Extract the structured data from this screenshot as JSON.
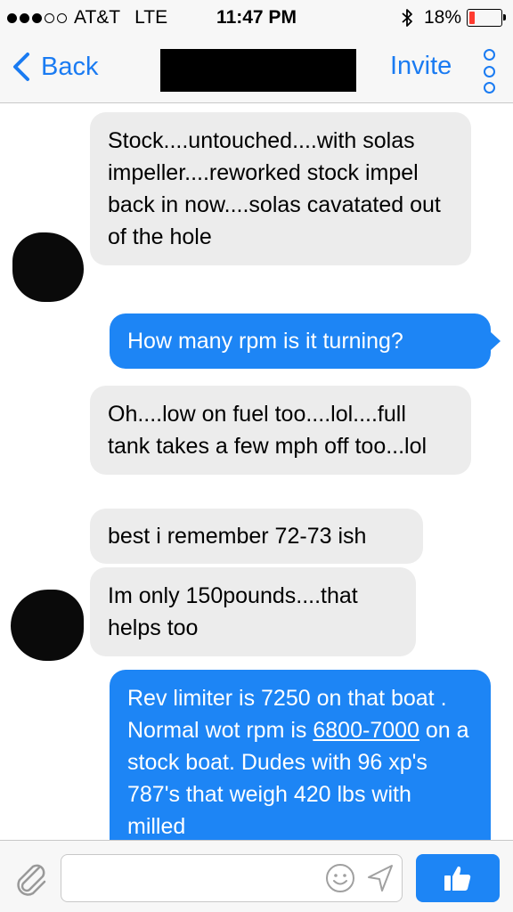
{
  "status_bar": {
    "carrier": "AT&T",
    "network": "LTE",
    "time": "11:47 PM",
    "battery": "18%",
    "battery_level": 0.18,
    "signal_bars_filled": 3,
    "signal_bars_total": 5
  },
  "nav": {
    "back_label": "Back",
    "invite_label": "Invite"
  },
  "messages": [
    {
      "direction": "incoming",
      "text": "Stock....untouched....with solas impeller....reworked stock impel back in now....solas cavatated out of the hole"
    },
    {
      "direction": "outgoing",
      "text": "How many rpm is it turning?"
    },
    {
      "direction": "incoming",
      "text": "Oh....low on fuel too....lol....full tank takes a few mph off too...lol"
    },
    {
      "direction": "incoming",
      "text": "best i remember 72-73 ish"
    },
    {
      "direction": "incoming",
      "text": "Im only 150pounds....that helps too"
    },
    {
      "direction": "outgoing",
      "text_before": "Rev limiter is 7250 on that boat . Normal wot rpm is ",
      "link": "6800-7000",
      "text_after": " on a stock boat. Dudes with 96 xp's 787's that weigh 420 lbs with milled"
    }
  ],
  "composer": {
    "placeholder": ""
  },
  "colors": {
    "accent": "#1a7bf2",
    "outgoing_bubble": "#1d85f5",
    "incoming_bubble": "#ececec",
    "battery_low": "#ff3b30"
  },
  "icons": [
    "back-chevron-icon",
    "more-options-icon",
    "paperclip-icon",
    "emoji-icon",
    "send-arrow-icon",
    "thumbs-up-icon",
    "bluetooth-icon",
    "battery-icon"
  ]
}
